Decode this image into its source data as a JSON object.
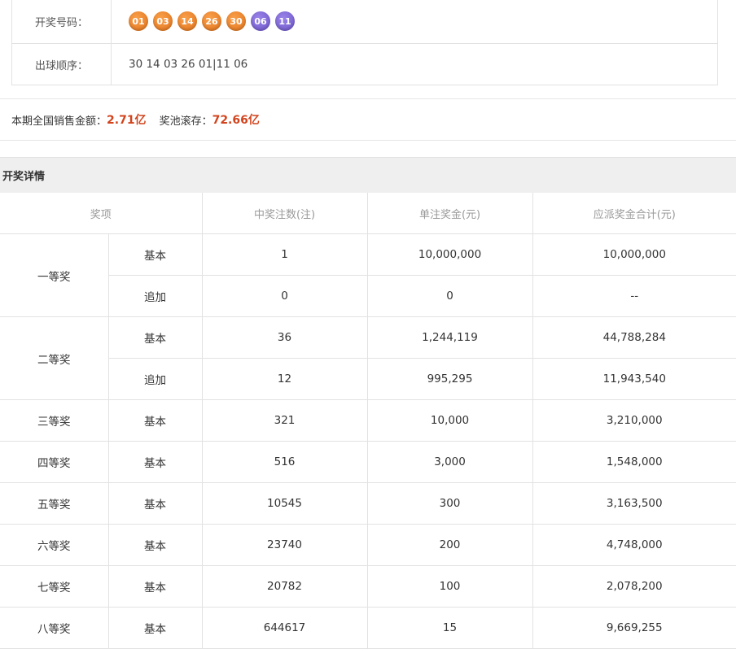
{
  "draw": {
    "numbers_label": "开奖号码：",
    "red_balls": [
      "01",
      "03",
      "14",
      "26",
      "30"
    ],
    "blue_balls": [
      "06",
      "11"
    ],
    "order_label": "出球顺序：",
    "order_value": "30 14 03 26 01|11 06"
  },
  "sales": {
    "sales_label": "本期全国销售金额：",
    "sales_value": "2.71亿",
    "pool_label": "奖池滚存：",
    "pool_value": "72.66亿"
  },
  "section": {
    "title": "开奖详情"
  },
  "table": {
    "headers": [
      "奖项",
      "中奖注数(注)",
      "单注奖金(元)",
      "应派奖金合计(元)"
    ],
    "groups": [
      {
        "prize": "一等奖",
        "rows": [
          {
            "type": "基本",
            "count": "1",
            "unit": "10,000,000",
            "total": "10,000,000"
          },
          {
            "type": "追加",
            "count": "0",
            "unit": "0",
            "total": "--"
          }
        ]
      },
      {
        "prize": "二等奖",
        "rows": [
          {
            "type": "基本",
            "count": "36",
            "unit": "1,244,119",
            "total": "44,788,284"
          },
          {
            "type": "追加",
            "count": "12",
            "unit": "995,295",
            "total": "11,943,540"
          }
        ]
      },
      {
        "prize": "三等奖",
        "rows": [
          {
            "type": "基本",
            "count": "321",
            "unit": "10,000",
            "total": "3,210,000"
          }
        ]
      },
      {
        "prize": "四等奖",
        "rows": [
          {
            "type": "基本",
            "count": "516",
            "unit": "3,000",
            "total": "1,548,000"
          }
        ]
      },
      {
        "prize": "五等奖",
        "rows": [
          {
            "type": "基本",
            "count": "10545",
            "unit": "300",
            "total": "3,163,500"
          }
        ]
      },
      {
        "prize": "六等奖",
        "rows": [
          {
            "type": "基本",
            "count": "23740",
            "unit": "200",
            "total": "4,748,000"
          }
        ]
      },
      {
        "prize": "七等奖",
        "rows": [
          {
            "type": "基本",
            "count": "20782",
            "unit": "100",
            "total": "2,078,200"
          }
        ]
      },
      {
        "prize": "八等奖",
        "rows": [
          {
            "type": "基本",
            "count": "644617",
            "unit": "15",
            "total": "9,669,255"
          }
        ]
      }
    ]
  },
  "colors": {
    "accent": "#d2441d",
    "red_ball": "#e2731a",
    "blue_ball": "#6c53c9"
  }
}
